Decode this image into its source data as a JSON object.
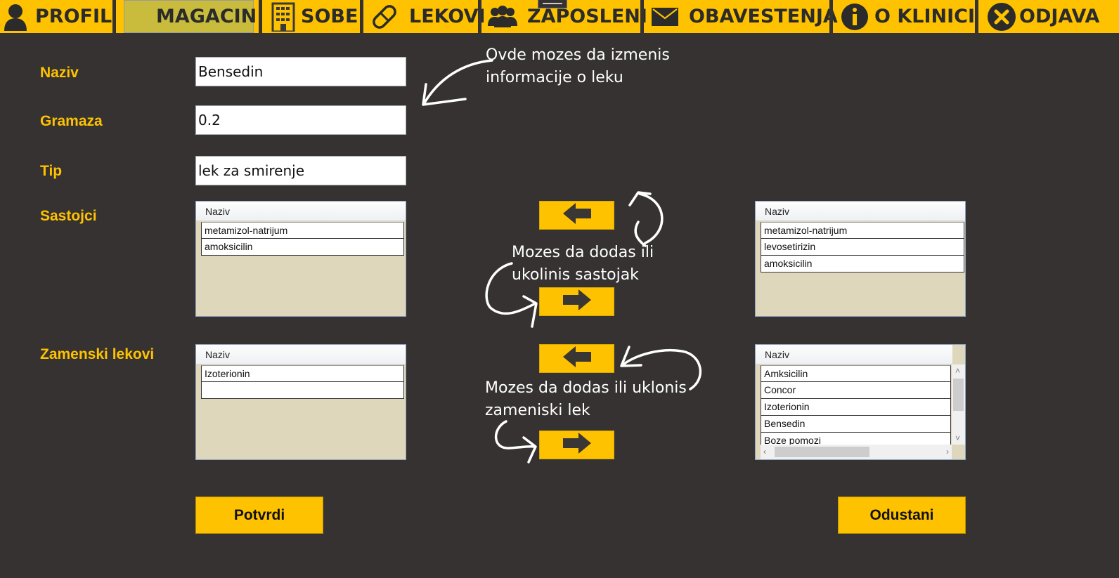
{
  "nav": {
    "items": [
      {
        "label": "PROFIL",
        "icon": "user-icon"
      },
      {
        "label": "MAGACIN",
        "icon": "warehouse-icon"
      },
      {
        "label": "SOBE",
        "icon": "building-icon"
      },
      {
        "label": "LEKOVI",
        "icon": "pill-icon"
      },
      {
        "label": "ZAPOSLENI",
        "icon": "group-icon"
      },
      {
        "label": "OBAVESTENJA",
        "icon": "envelope-icon"
      },
      {
        "label": "O KLINICI",
        "icon": "info-icon"
      },
      {
        "label": "ODJAVA",
        "icon": "close-circle-icon"
      }
    ],
    "active": "MAGACIN"
  },
  "form": {
    "naziv_label": "Naziv",
    "naziv_value": "Bensedin",
    "gramaza_label": "Gramaza",
    "gramaza_value": "0.2",
    "tip_label": "Tip",
    "tip_value": "lek za smirenje",
    "sastojci_label": "Sastojci",
    "zamenski_label": "Zamenski lekovi"
  },
  "lists": {
    "sastojci_selected": {
      "header": "Naziv",
      "items": [
        "metamizol-natrijum",
        "amoksicilin"
      ]
    },
    "sastojci_available": {
      "header": "Naziv",
      "items": [
        "metamizol-natrijum",
        "levosetirizin",
        "amoksicilin"
      ]
    },
    "zamenski_selected": {
      "header": "Naziv",
      "items": [
        "Izoterionin",
        ""
      ]
    },
    "zamenski_available": {
      "header": "Naziv",
      "items": [
        "Amksicilin",
        "Concor",
        "Izoterionin",
        "Bensedin",
        "Boze pomozi"
      ]
    }
  },
  "hints": {
    "edit_line1": "Ovde mozes da izmenis",
    "edit_line2": "informacije o leku",
    "sastojak_line1": "Mozes da dodas ili",
    "sastojak_line2": "ukolinis sastojak",
    "zamenski_line1": "Mozes da dodas ili uklonis",
    "zamenski_line2": "zameniski lek"
  },
  "actions": {
    "confirm_label": "Potvrdi",
    "cancel_label": "Odustani"
  },
  "colors": {
    "accent": "#FFC200",
    "background": "#353231",
    "list_background": "#DFD7BC",
    "active_tab": "#C9BC3C"
  }
}
